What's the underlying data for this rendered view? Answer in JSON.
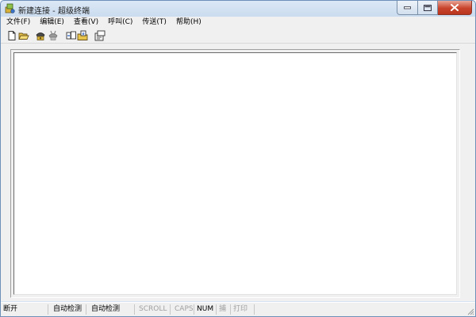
{
  "window": {
    "title": "新建连接 - 超级终端"
  },
  "menu": {
    "items": [
      "文件(F)",
      "编辑(E)",
      "查看(V)",
      "呼叫(C)",
      "传送(T)",
      "帮助(H)"
    ]
  },
  "toolbar": {
    "buttons": [
      "new-document-icon",
      "open-folder-icon",
      "dial-phone-icon",
      "hang-up-icon",
      "send-file-icon",
      "receive-file-icon",
      "properties-icon"
    ]
  },
  "status": {
    "panes": [
      {
        "label": "断开",
        "enabled": true
      },
      {
        "label": "自动检测",
        "enabled": true
      },
      {
        "label": "自动检测",
        "enabled": true
      },
      {
        "label": "SCROLL",
        "enabled": false
      },
      {
        "label": "CAPS",
        "enabled": false
      },
      {
        "label": "NUM",
        "enabled": true
      },
      {
        "label": "捕",
        "enabled": false
      },
      {
        "label": "打印",
        "enabled": false
      }
    ]
  },
  "colors": {
    "window_border": "#6d8fb8",
    "close_button": "#c9432c",
    "terminal_bg": "#ffffff",
    "disabled_text": "#a0a0a0"
  }
}
